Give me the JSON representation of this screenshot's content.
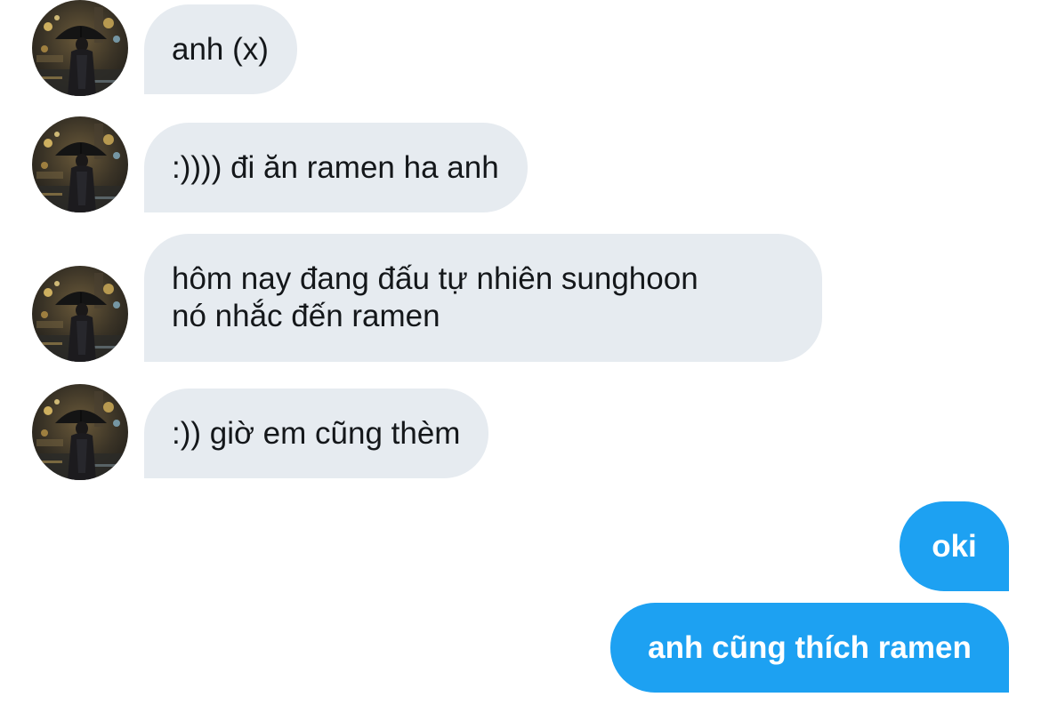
{
  "conversation": {
    "received": [
      {
        "text": "anh (x)"
      },
      {
        "text": ":)))) đi ăn ramen ha anh"
      },
      {
        "text": "hôm nay đang đấu tự nhiên sunghoon\nnó nhắc đến ramen"
      },
      {
        "text": ":)) giờ em cũng thèm"
      }
    ],
    "sent": [
      {
        "text": "oki"
      },
      {
        "text": "anh cũng thích ramen"
      }
    ]
  },
  "colors": {
    "received_bubble": "#e6ebf0",
    "received_text": "#14171a",
    "sent_bubble": "#1da1f2",
    "sent_text": "#ffffff"
  }
}
